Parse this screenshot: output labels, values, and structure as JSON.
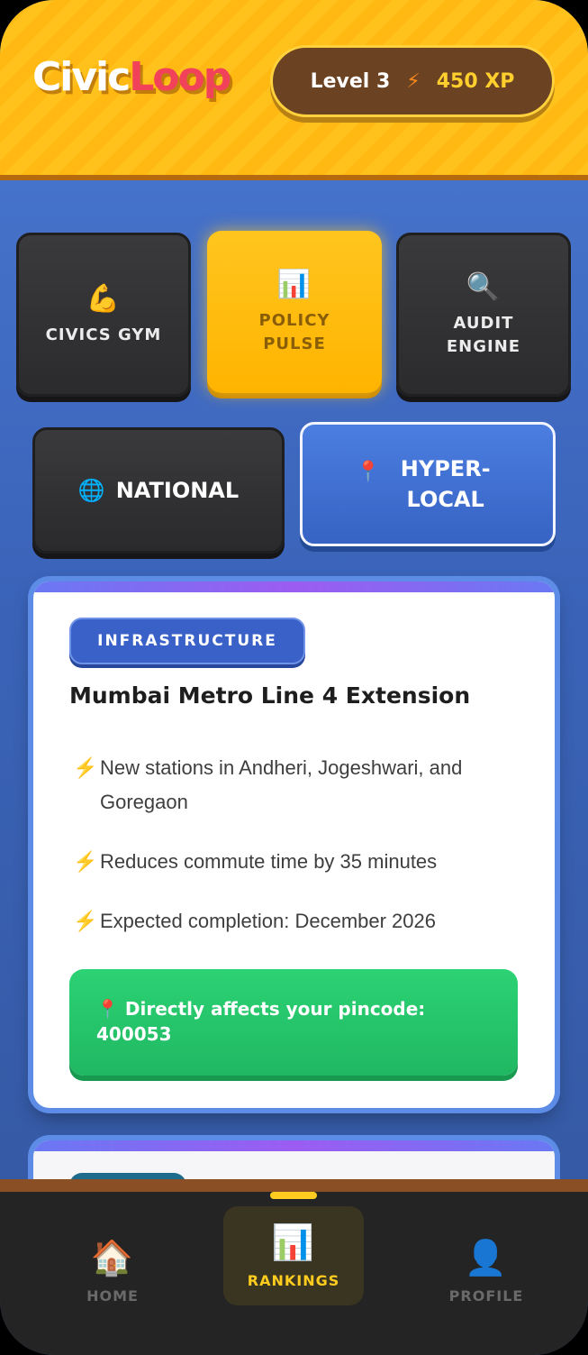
{
  "header": {
    "logo_part1": "Civic",
    "logo_part2": "Loop",
    "level": "Level 3",
    "xp": "450 XP"
  },
  "modes": [
    {
      "label": "CIVICS GYM",
      "icon": "flexed-biceps-icon",
      "selected": false
    },
    {
      "label": "POLICY PULSE",
      "icon": "bar-chart-icon",
      "selected": true
    },
    {
      "label": "AUDIT ENGINE",
      "icon": "magnifier-icon",
      "selected": false
    }
  ],
  "scopes": [
    {
      "label": "NATIONAL",
      "icon": "globe-icon",
      "selected": false
    },
    {
      "label": "HYPER-LOCAL",
      "icon": "pin-icon",
      "selected": true
    }
  ],
  "card": {
    "category": "INFRASTRUCTURE",
    "title": "Mumbai Metro Line 4 Extension",
    "points": [
      "New stations in Andheri, Jogeshwari, and Goregaon",
      "Reduces commute time by 35 minutes",
      "Expected completion: December 2026"
    ],
    "impact": "Directly affects your pincode: 400053"
  },
  "nav": {
    "home": "HOME",
    "rankings": "RANKINGS",
    "profile": "PROFILE",
    "active": "rankings"
  },
  "colors": {
    "gold": "#ffc21c",
    "blue": "#3a63b8",
    "green": "#22bf67",
    "coral": "#f2425a"
  }
}
